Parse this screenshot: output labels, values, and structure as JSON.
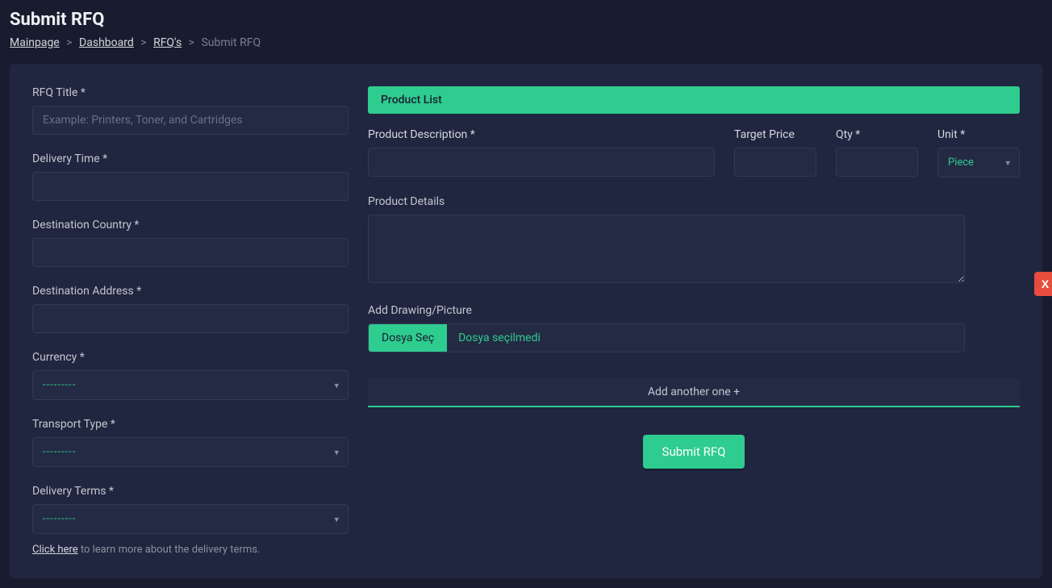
{
  "header": {
    "title": "Submit RFQ",
    "breadcrumb": {
      "mainpage": "Mainpage",
      "dashboard": "Dashboard",
      "rfqs": "RFQ's",
      "current": "Submit RFQ",
      "sep": ">"
    }
  },
  "left": {
    "rfq_title_label": "RFQ Title *",
    "rfq_title_placeholder": "Example: Printers, Toner, and Cartridges",
    "delivery_time_label": "Delivery Time *",
    "dest_country_label": "Destination Country *",
    "dest_address_label": "Destination Address *",
    "currency_label": "Currency *",
    "currency_placeholder": "---------",
    "transport_label": "Transport Type *",
    "transport_placeholder": "---------",
    "delivery_terms_label": "Delivery Terms *",
    "delivery_terms_placeholder": "---------",
    "help_link": "Click here",
    "help_rest": " to learn more about the delivery terms."
  },
  "right": {
    "product_list_header": "Product List",
    "product_desc_label": "Product Description *",
    "target_price_label": "Target Price",
    "qty_label": "Qty *",
    "unit_label": "Unit *",
    "unit_value": "Piece",
    "product_details_label": "Product Details",
    "add_drawing_label": "Add Drawing/Picture",
    "file_button": "Dosya Seç",
    "file_status": "Dosya seçilmedi",
    "remove_btn": "X",
    "add_another": "Add another one +",
    "submit_btn": "Submit RFQ"
  }
}
